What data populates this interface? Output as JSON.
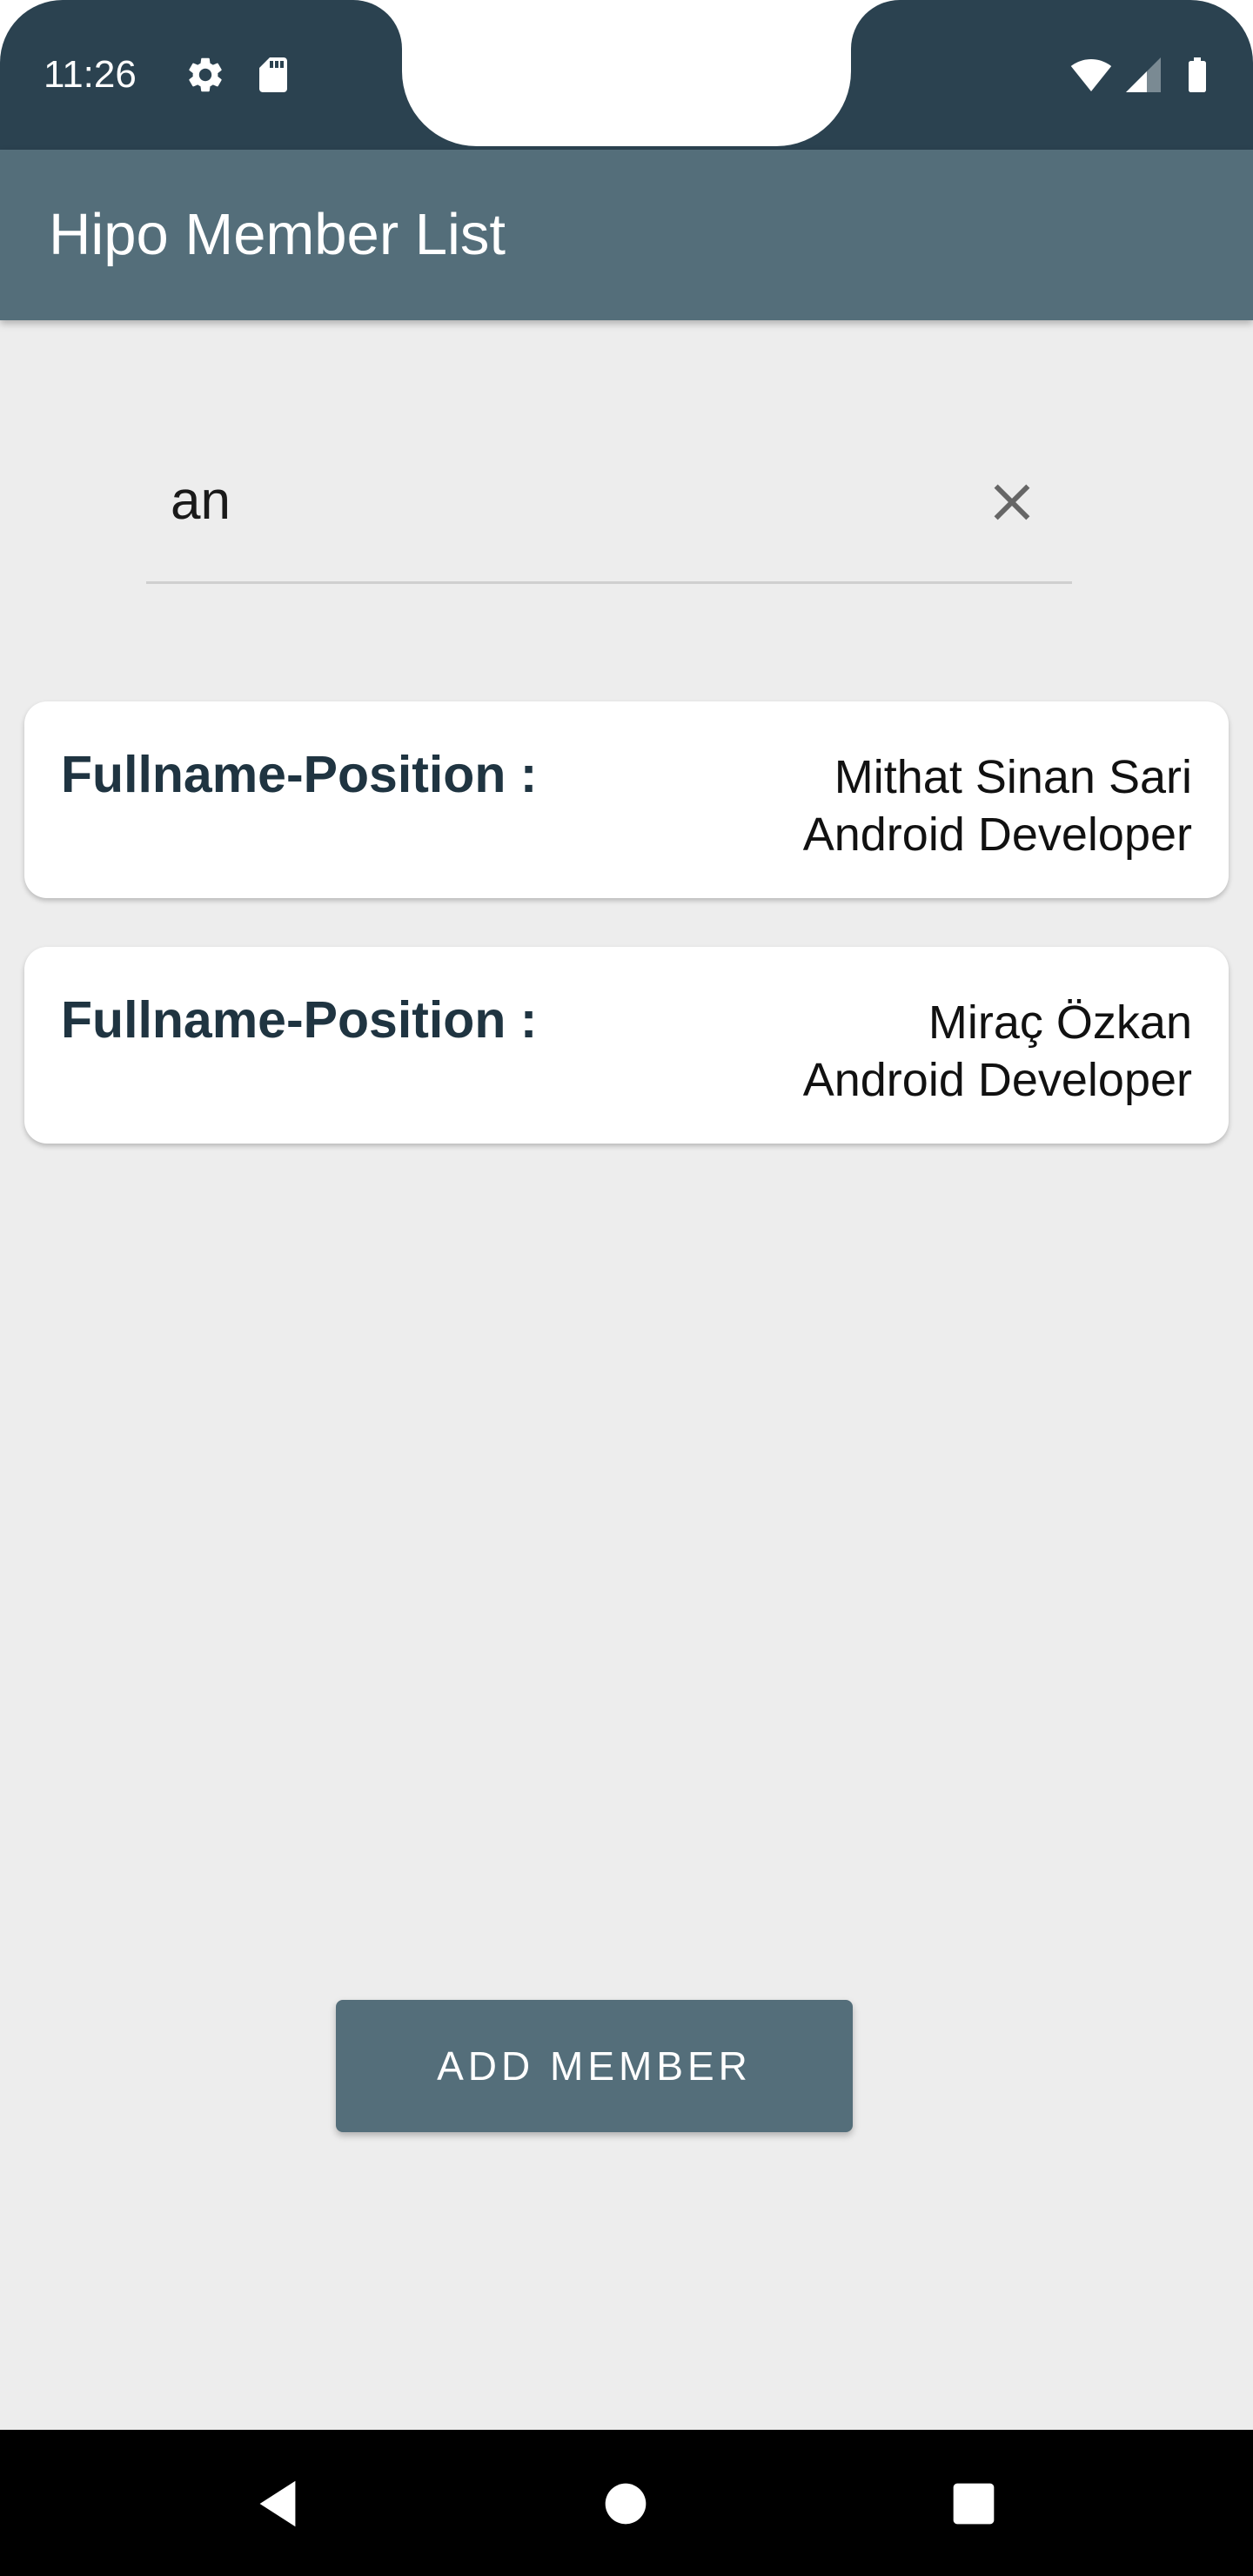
{
  "status_bar": {
    "time": "11:26",
    "icons": [
      "gear-icon",
      "sd-card-icon",
      "wifi-icon",
      "cell-signal-icon",
      "battery-icon"
    ]
  },
  "app_bar": {
    "title": "Hipo Member List"
  },
  "search": {
    "value": "an",
    "clear_icon": "close-icon"
  },
  "members": [
    {
      "label": "Fullname-Position :",
      "value": "Mithat Sinan Sari \nAndroid Developer"
    },
    {
      "label": "Fullname-Position :",
      "value": "Miraç Özkan \nAndroid Developer"
    }
  ],
  "add_button": {
    "label": "ADD MEMBER"
  },
  "nav_bar": {
    "buttons": [
      "back-icon",
      "home-icon",
      "recents-icon"
    ]
  },
  "colors": {
    "status_bar": "#2b4250",
    "app_bar": "#546e7a",
    "background": "#ededed",
    "card_label": "#1f3441",
    "button": "#546e7a"
  }
}
